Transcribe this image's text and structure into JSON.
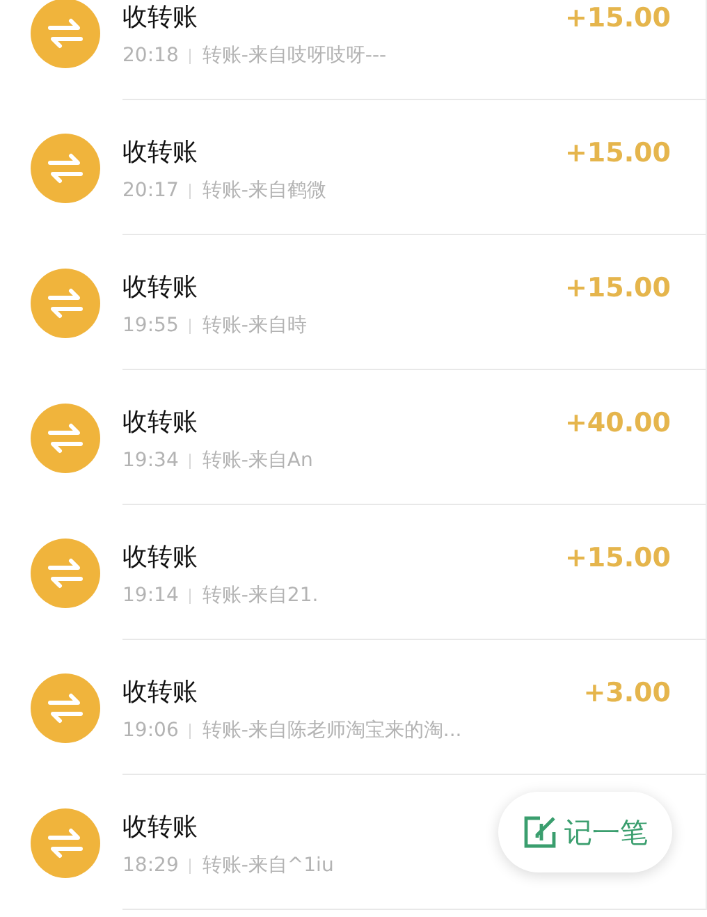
{
  "transactions": [
    {
      "title": "收转账",
      "time": "20:18",
      "note": "转账-来自吱呀吱呀---",
      "amount": "+15.00"
    },
    {
      "title": "收转账",
      "time": "20:17",
      "note": "转账-来自鹤微",
      "amount": "+15.00"
    },
    {
      "title": "收转账",
      "time": "19:55",
      "note": "转账-来自時",
      "amount": "+15.00"
    },
    {
      "title": "收转账",
      "time": "19:34",
      "note": "转账-来自An",
      "amount": "+40.00"
    },
    {
      "title": "收转账",
      "time": "19:14",
      "note": "转账-来自21.",
      "amount": "+15.00"
    },
    {
      "title": "收转账",
      "time": "19:06",
      "note": "转账-来自陈老师淘宝来的淘...",
      "amount": "+3.00"
    },
    {
      "title": "收转账",
      "time": "18:29",
      "note": "转账-来自^1iu"
    }
  ],
  "note_button": {
    "label": "记一笔"
  }
}
